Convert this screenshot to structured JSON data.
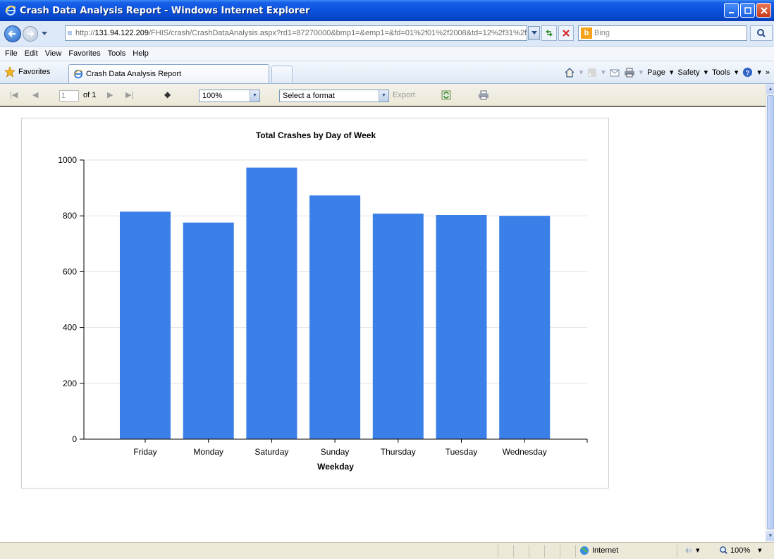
{
  "window": {
    "title": "Crash Data Analysis Report - Windows Internet Explorer"
  },
  "address": {
    "url_host_prefix": "http://",
    "url_host": "131.94.122.209",
    "url_rest": "/FHIS/crash/CrashDataAnalysis.aspx?rd1=87270000&bmp1=&emp1=&fd=01%2f01%2f2008&td=12%2f31%2f",
    "search_placeholder": "Bing"
  },
  "menu": [
    "File",
    "Edit",
    "View",
    "Favorites",
    "Tools",
    "Help"
  ],
  "favorites_bar": {
    "favorites_label": "Favorites",
    "tab_title": "Crash Data Analysis Report",
    "commands": [
      "Page",
      "Safety",
      "Tools"
    ]
  },
  "report_toolbar": {
    "page_value": "1",
    "page_of": "of 1",
    "zoom": "100%",
    "format_placeholder": "Select a format",
    "export_label": "Export"
  },
  "status": {
    "zone": "Internet",
    "zoom": "100%"
  },
  "chart_data": {
    "type": "bar",
    "title": "Total Crashes by Day of Week",
    "xlabel": "Weekday",
    "ylabel": "",
    "categories": [
      "Friday",
      "Monday",
      "Saturday",
      "Sunday",
      "Thursday",
      "Tuesday",
      "Wednesday"
    ],
    "values": [
      815,
      776,
      973,
      873,
      808,
      803,
      800
    ],
    "ylim": [
      0,
      1000
    ],
    "yticks": [
      0,
      200,
      400,
      600,
      800,
      1000
    ],
    "grid": true,
    "bar_color": "#3b7fe8"
  }
}
